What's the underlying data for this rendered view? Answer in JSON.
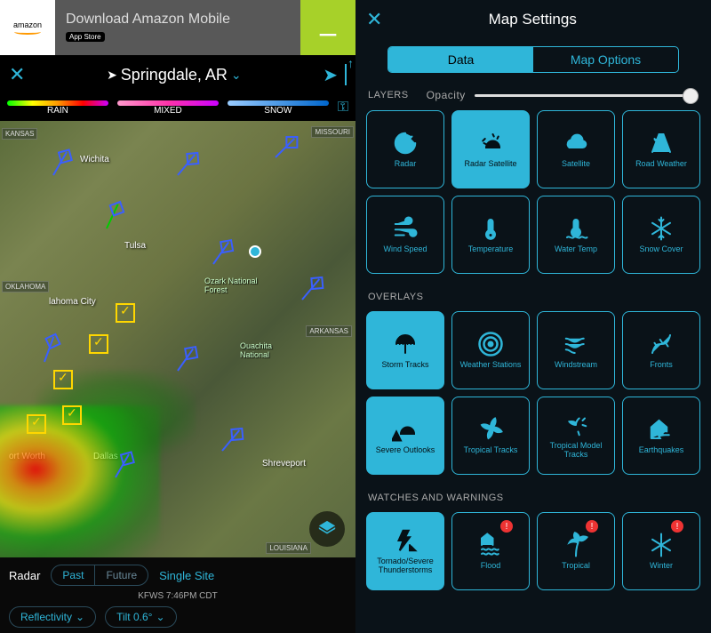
{
  "ad": {
    "logo_text": "amazon",
    "title": "Download Amazon Mobile",
    "store": "App Store"
  },
  "topbar": {
    "location": "Springdale, AR"
  },
  "legend": {
    "rain": "RAIN",
    "mixed": "MIXED",
    "snow": "SNOW"
  },
  "map_labels": {
    "kansas": "KANSAS",
    "missouri": "MISSOURI",
    "oklahoma": "OKLAHOMA",
    "arkansas": "ARKANSAS",
    "louisiana": "LOUISIANA",
    "wichita": "Wichita",
    "tulsa": "Tulsa",
    "okc": "lahoma City",
    "dallas": "Dallas",
    "fortworth": "ort Worth",
    "shreveport": "Shreveport",
    "ozark": "Ozark National\nForest",
    "ouachita": "Ouachita\nNational"
  },
  "bottom": {
    "mode": "Radar",
    "past": "Past",
    "future": "Future",
    "single": "Single Site",
    "station": "KFWS 7:46PM CDT",
    "reflectivity": "Reflectivity",
    "tilt": "Tilt 0.6°"
  },
  "settings": {
    "title": "Map Settings",
    "tab_data": "Data",
    "tab_map": "Map Options",
    "section_layers": "LAYERS",
    "opacity_label": "Opacity",
    "section_overlays": "OVERLAYS",
    "section_watches": "WATCHES AND WARNINGS",
    "layers": [
      {
        "label": "Radar",
        "icon": "radar",
        "active": false
      },
      {
        "label": "Radar Satellite",
        "icon": "radar-sat",
        "active": true
      },
      {
        "label": "Satellite",
        "icon": "cloud",
        "active": false
      },
      {
        "label": "Road Weather",
        "icon": "road",
        "active": false
      },
      {
        "label": "Wind Speed",
        "icon": "wind",
        "active": false
      },
      {
        "label": "Temperature",
        "icon": "temp",
        "active": false
      },
      {
        "label": "Water Temp",
        "icon": "water-temp",
        "active": false
      },
      {
        "label": "Snow Cover",
        "icon": "snow",
        "active": false
      }
    ],
    "overlays": [
      {
        "label": "Storm Tracks",
        "icon": "storm-tracks",
        "active": true
      },
      {
        "label": "Weather Stations",
        "icon": "stations",
        "active": false
      },
      {
        "label": "Windstream",
        "icon": "windstream",
        "active": false
      },
      {
        "label": "Fronts",
        "icon": "fronts",
        "active": false
      },
      {
        "label": "Severe Outlooks",
        "icon": "severe",
        "active": true
      },
      {
        "label": "Tropical Tracks",
        "icon": "tropical",
        "active": false
      },
      {
        "label": "Tropical Model Tracks",
        "icon": "tropical-model",
        "active": false
      },
      {
        "label": "Earthquakes",
        "icon": "quake",
        "active": false
      }
    ],
    "watches": [
      {
        "label": "Tornado/Severe Thunderstorms",
        "icon": "tornado",
        "active": true,
        "alert": false
      },
      {
        "label": "Flood",
        "icon": "flood",
        "active": false,
        "alert": true
      },
      {
        "label": "Tropical",
        "icon": "palm",
        "active": false,
        "alert": true
      },
      {
        "label": "Winter",
        "icon": "winter",
        "active": false,
        "alert": true
      }
    ]
  }
}
